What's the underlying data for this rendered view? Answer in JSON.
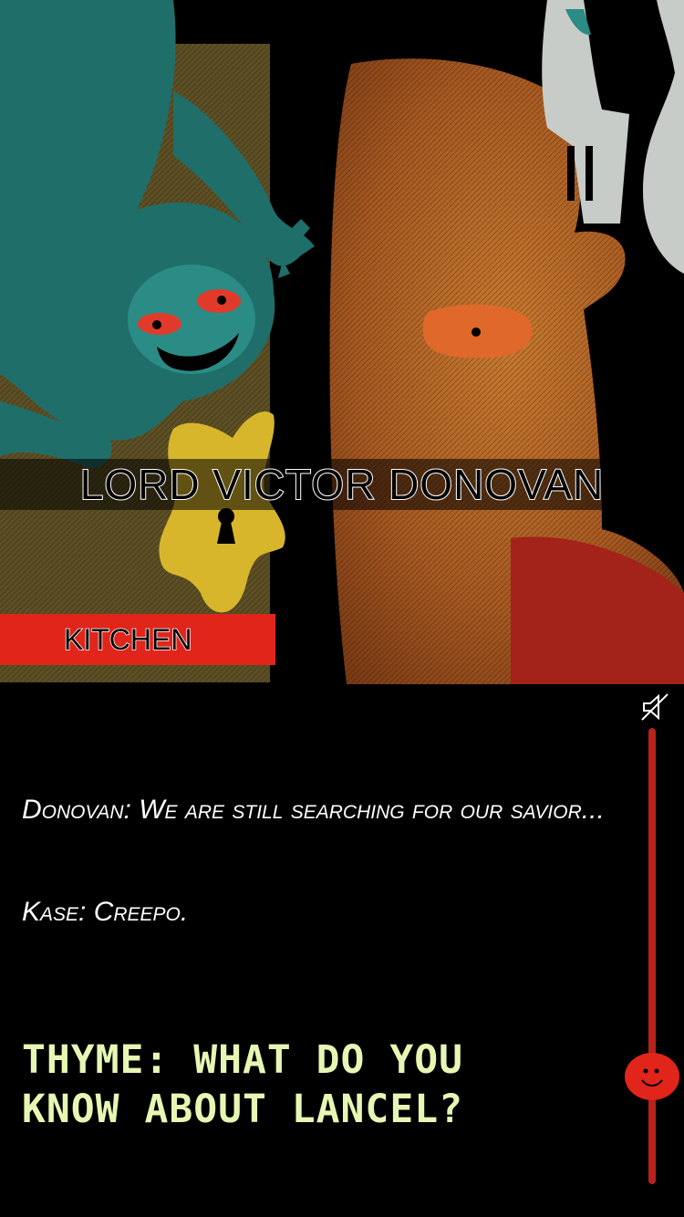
{
  "scene": {
    "character_name": "LORD VICTOR DONOVAN",
    "location": "KITCHEN"
  },
  "dialogue": {
    "line1": "Donovan: We are still searching for our savior...",
    "line2": "Kase: Creepo."
  },
  "choice": {
    "text": "THYME: WHAT DO YOU KNOW ABOUT LANCEL?"
  },
  "controls": {
    "mute_icon": "speaker-muted-icon",
    "scroll_level": 0.72,
    "knob_icon": "smiley-face-icon"
  },
  "colors": {
    "accent_red": "#e1251b",
    "choice_text": "#e6f7b4",
    "slider": "#b5231b"
  }
}
